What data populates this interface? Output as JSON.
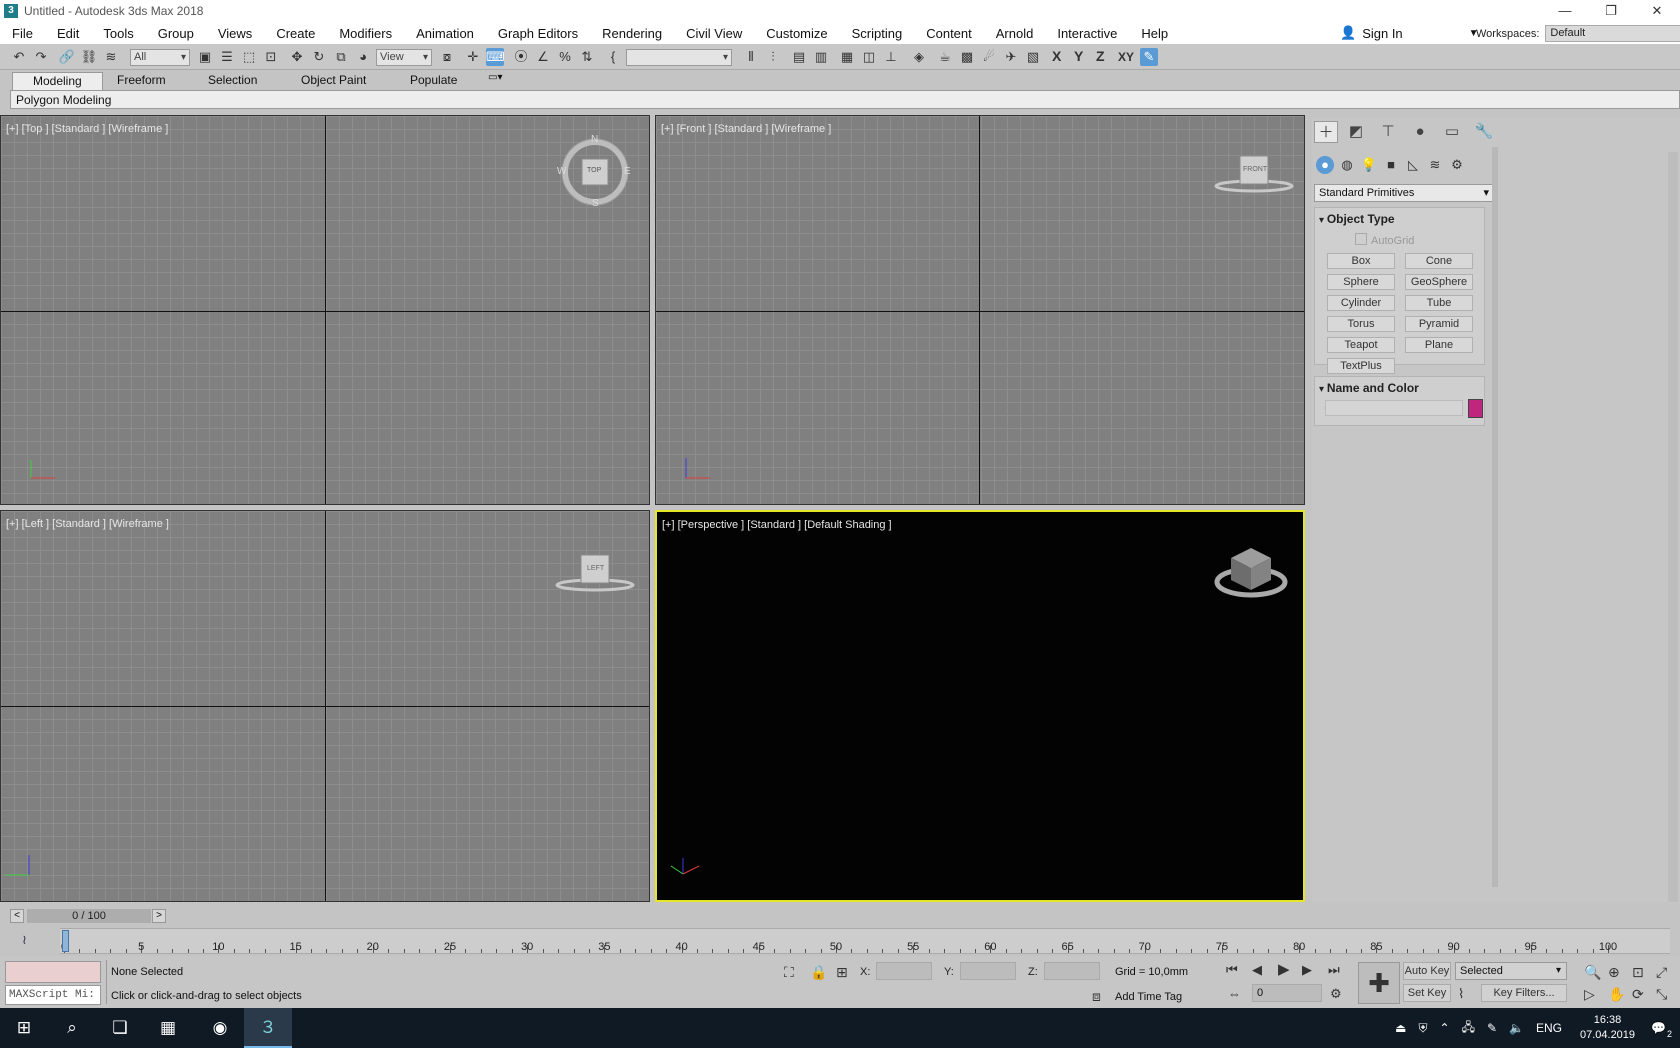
{
  "window": {
    "title": "Untitled - Autodesk 3ds Max 2018",
    "app_icon": "3",
    "minimize": "—",
    "restore": "❐",
    "close": "✕"
  },
  "menu": [
    "File",
    "Edit",
    "Tools",
    "Group",
    "Views",
    "Create",
    "Modifiers",
    "Animation",
    "Graph Editors",
    "Rendering",
    "Civil View",
    "Customize",
    "Scripting",
    "Content",
    "Arnold",
    "Interactive",
    "Help"
  ],
  "account": {
    "sign_in": "Sign In",
    "workspaces_label": "Workspaces:",
    "workspace": "Default"
  },
  "toolbar": {
    "selection_filter": "All",
    "ref_coord": "View",
    "named_selection": "",
    "axis_x": "X",
    "axis_y": "Y",
    "axis_z": "Z",
    "axis_xy": "XY"
  },
  "ribbon": {
    "tabs": [
      "Modeling",
      "Freeform",
      "Selection",
      "Object Paint",
      "Populate"
    ],
    "active_tab": "Modeling",
    "panel": "Polygon Modeling"
  },
  "viewports": {
    "top": {
      "label": "[+] [Top ] [Standard ] [Wireframe ]",
      "cube": "TOP",
      "n": "N",
      "s": "S",
      "w": "W",
      "e": "E"
    },
    "front": {
      "label": "[+] [Front ] [Standard ] [Wireframe ]",
      "cube": "FRONT"
    },
    "left": {
      "label": "[+] [Left ] [Standard ] [Wireframe ]",
      "cube": "LEFT"
    },
    "perspective": {
      "label": "[+] [Perspective ] [Standard ] [Default Shading ]"
    }
  },
  "command_panel": {
    "category": "Standard Primitives",
    "object_type": {
      "title": "Object Type",
      "autogrid": "AutoGrid",
      "buttons": [
        "Box",
        "Cone",
        "Sphere",
        "GeoSphere",
        "Cylinder",
        "Tube",
        "Torus",
        "Pyramid",
        "Teapot",
        "Plane",
        "TextPlus"
      ]
    },
    "name_and_color": {
      "title": "Name and Color",
      "name_value": "",
      "color": "#c0267e"
    }
  },
  "time": {
    "frame_display": "0 / 100",
    "prev": "<",
    "next": ">",
    "ticks": [
      "0",
      "5",
      "10",
      "15",
      "20",
      "25",
      "30",
      "35",
      "40",
      "45",
      "50",
      "55",
      "60",
      "65",
      "70",
      "75",
      "80",
      "85",
      "90",
      "95",
      "100"
    ],
    "current_frame": "0"
  },
  "status": {
    "maxscript_placeholder": "MAXScript Mi:",
    "selection": "None Selected",
    "prompt": "Click or click-and-drag to select objects",
    "x_label": "X:",
    "y_label": "Y:",
    "z_label": "Z:",
    "grid": "Grid = 10,0mm",
    "add_time_tag": "Add Time Tag",
    "auto_key": "Auto Key",
    "set_key": "Set Key",
    "key_mode": "Selected",
    "key_filters": "Key Filters..."
  },
  "taskbar": {
    "language": "ENG",
    "time": "16:38",
    "date": "07.04.2019",
    "notifications": "2"
  }
}
